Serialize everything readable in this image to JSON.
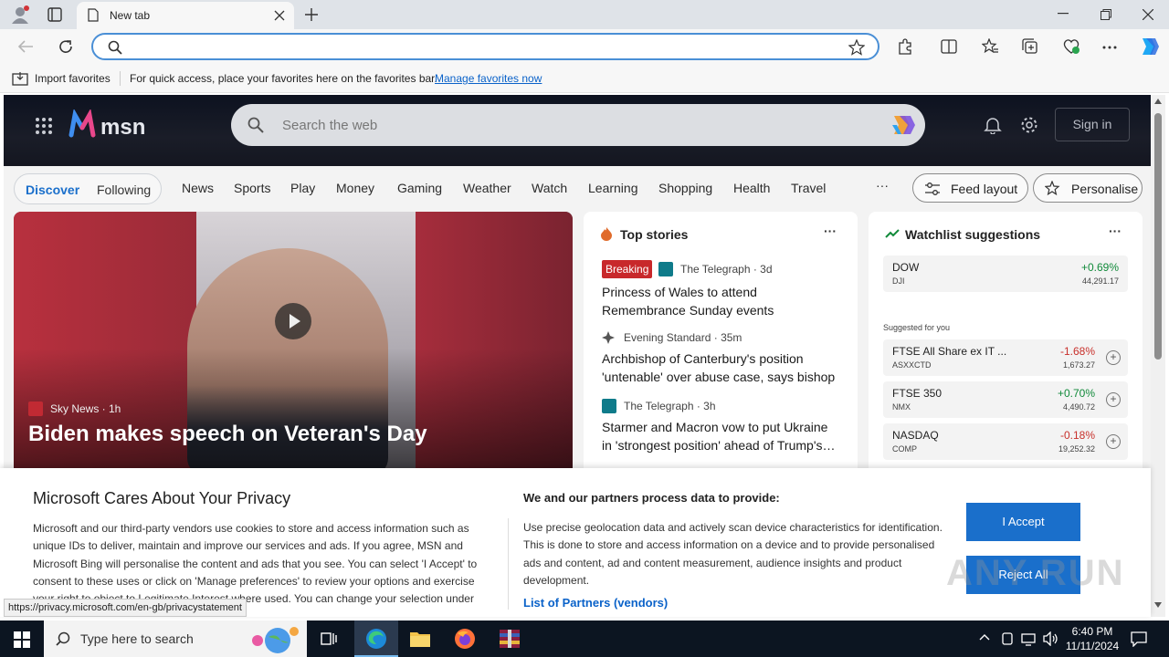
{
  "browser": {
    "tab_title": "New tab",
    "favbar_import": "Import favorites",
    "favbar_hint": "For quick access, place your favorites here on the favorites bar.",
    "favbar_manage": "Manage favorites now",
    "status_url": "https://privacy.microsoft.com/en-gb/privacystatement"
  },
  "msn": {
    "logo_text": "msn",
    "search_placeholder": "Search the web",
    "sign_in": "Sign in",
    "nav_pill": [
      "Discover",
      "Following"
    ],
    "nav": [
      "News",
      "Sports",
      "Play",
      "Money",
      "Gaming",
      "Weather",
      "Watch",
      "Learning",
      "Shopping",
      "Health",
      "Travel"
    ],
    "more": "···",
    "feed_layout": "Feed layout",
    "personalise": "Personalise"
  },
  "hero": {
    "source": "Sky News · 1h",
    "title": "Biden makes speech on Veteran's Day"
  },
  "top_stories": {
    "title": "Top stories",
    "more": "···",
    "items": [
      {
        "badge": "Breaking",
        "source": "The Telegraph · 3d",
        "headline": "Princess of Wales to attend Remembrance Sunday events"
      },
      {
        "source": "Evening Standard · 35m",
        "headline": "Archbishop of Canterbury's position 'untenable' over abuse case, says bishop"
      },
      {
        "source": "The Telegraph · 3h",
        "headline": "Starmer and Macron vow to put Ukraine in 'strongest position' ahead of Trump's…"
      }
    ]
  },
  "watchlist": {
    "title": "Watchlist suggestions",
    "more": "···",
    "suggested_label": "Suggested for you",
    "stocks": [
      {
        "name": "DOW",
        "symbol": "DJI",
        "change": "+0.69%",
        "value": "44,291.17"
      },
      {
        "name": "FTSE All Share ex IT ...",
        "symbol": "ASXXCTD",
        "change": "-1.68%",
        "value": "1,673.27"
      },
      {
        "name": "FTSE 350",
        "symbol": "NMX",
        "change": "+0.70%",
        "value": "4,490.72"
      },
      {
        "name": "NASDAQ",
        "symbol": "COMP",
        "change": "-0.18%",
        "value": "19,252.32"
      }
    ]
  },
  "privacy": {
    "title": "Microsoft Cares About Your Privacy",
    "body": "Microsoft and our third-party vendors use cookies to store and access information such as unique IDs to deliver, maintain and improve our services and ads. If you agree, MSN and Microsoft Bing will personalise the content and ads that you see. You can select 'I Accept' to consent to these uses or click on 'Manage preferences' to review your options and exercise your right to object to Legitimate Interest where used. You can change your selection under 'Manage Preferences' at the bottom of",
    "process_title": "We and our partners process data to provide:",
    "process_body": "Use precise geolocation data and actively scan device characteristics for identification. This is done to store and access information on a device and to provide personalised ads and content, ad and content measurement, audience insights and product development.",
    "partners_link": "List of Partners (vendors)",
    "accept": "I Accept",
    "reject": "Reject All"
  },
  "taskbar": {
    "search_placeholder": "Type here to search",
    "time": "6:40 PM",
    "date": "11/11/2024"
  },
  "watermark": "ANY RUN",
  "colors": {
    "accent": "#1a6fcb",
    "positive": "#118a3a",
    "negative": "#c8302b"
  }
}
